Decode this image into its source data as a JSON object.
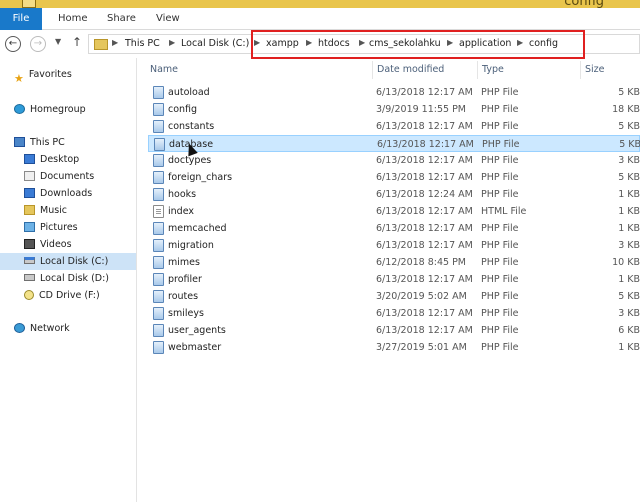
{
  "window": {
    "title": "config"
  },
  "ribbon": {
    "tabs": [
      {
        "label": "File"
      },
      {
        "label": "Home"
      },
      {
        "label": "Share"
      },
      {
        "label": "View"
      }
    ]
  },
  "address": {
    "crumbs": [
      "This PC",
      "Local Disk (C:)",
      "xampp",
      "htdocs",
      "cms_sekolahku",
      "application",
      "config"
    ]
  },
  "highlight": {
    "color": "#e02020"
  },
  "sidebar": {
    "favorites": "Favorites",
    "homegroup": "Homegroup",
    "thispc": "This PC",
    "items": [
      "Desktop",
      "Documents",
      "Downloads",
      "Music",
      "Pictures",
      "Videos",
      "Local Disk (C:)",
      "Local Disk (D:)",
      "CD Drive (F:)"
    ],
    "network": "Network",
    "selected": "Local Disk (C:)"
  },
  "columns": {
    "name": "Name",
    "date": "Date modified",
    "type": "Type",
    "size": "Size"
  },
  "files": [
    {
      "name": "autoload",
      "date": "6/13/2018 12:17 AM",
      "type": "PHP File",
      "size": "5 KB"
    },
    {
      "name": "config",
      "date": "3/9/2019 11:55 PM",
      "type": "PHP File",
      "size": "18 KB"
    },
    {
      "name": "constants",
      "date": "6/13/2018 12:17 AM",
      "type": "PHP File",
      "size": "5 KB"
    },
    {
      "name": "database",
      "date": "6/13/2018 12:17 AM",
      "type": "PHP File",
      "size": "5 KB",
      "selected": true
    },
    {
      "name": "doctypes",
      "date": "6/13/2018 12:17 AM",
      "type": "PHP File",
      "size": "3 KB"
    },
    {
      "name": "foreign_chars",
      "date": "6/13/2018 12:17 AM",
      "type": "PHP File",
      "size": "5 KB"
    },
    {
      "name": "hooks",
      "date": "6/13/2018 12:24 AM",
      "type": "PHP File",
      "size": "1 KB"
    },
    {
      "name": "index",
      "date": "6/13/2018 12:17 AM",
      "type": "HTML File",
      "size": "1 KB"
    },
    {
      "name": "memcached",
      "date": "6/13/2018 12:17 AM",
      "type": "PHP File",
      "size": "1 KB"
    },
    {
      "name": "migration",
      "date": "6/13/2018 12:17 AM",
      "type": "PHP File",
      "size": "3 KB"
    },
    {
      "name": "mimes",
      "date": "6/12/2018 8:45 PM",
      "type": "PHP File",
      "size": "10 KB"
    },
    {
      "name": "profiler",
      "date": "6/13/2018 12:17 AM",
      "type": "PHP File",
      "size": "1 KB"
    },
    {
      "name": "routes",
      "date": "3/20/2019 5:02 AM",
      "type": "PHP File",
      "size": "5 KB"
    },
    {
      "name": "smileys",
      "date": "6/13/2018 12:17 AM",
      "type": "PHP File",
      "size": "3 KB"
    },
    {
      "name": "user_agents",
      "date": "6/13/2018 12:17 AM",
      "type": "PHP File",
      "size": "6 KB"
    },
    {
      "name": "webmaster",
      "date": "3/27/2019 5:01 AM",
      "type": "PHP File",
      "size": "1 KB"
    }
  ]
}
